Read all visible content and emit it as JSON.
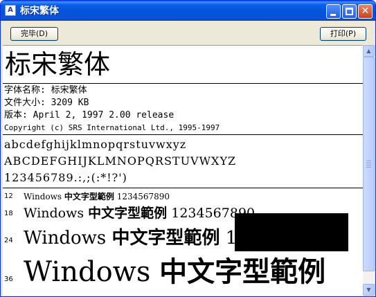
{
  "window": {
    "title": "标宋繁体",
    "icon": "font-file-icon",
    "icon_glyph": "A",
    "close_glyph": "✕"
  },
  "toolbar": {
    "done_label": "完毕(D)",
    "print_label": "打印(P)"
  },
  "preview": {
    "font_display_name": "标宋繁体",
    "info": {
      "name_line": "字体名称: 标宋繁体",
      "size_line": "文件大小: 3209 KB",
      "version_line": "版本: April 2, 1997 2.00 release",
      "copyright_line": "Copyright (c) SRS International Ltd., 1995-1997"
    },
    "samples": {
      "lowercase": "abcdefghijklmnopqrstuvwxyz",
      "uppercase": "ABCDEFGHIJKLMNOPQRSTUVWXYZ",
      "digits": "123456789.:,;(:*!?')"
    },
    "size_rows": [
      {
        "size": "12",
        "latin": "Windows",
        "cjk": "中文字型範例",
        "digits": "1234567890"
      },
      {
        "size": "18",
        "latin": "Windows",
        "cjk": "中文字型範例",
        "digits": "1234567890"
      },
      {
        "size": "24",
        "latin": "Windows",
        "cjk": "中文字型範例",
        "digits": "1234567890"
      },
      {
        "size": "36",
        "latin": "Windows",
        "cjk": "中文字型範例",
        "digits": ""
      }
    ]
  },
  "scrollbar": {
    "up_glyph": "▲",
    "down_glyph": "▼"
  },
  "colors": {
    "titlebar": "#0453d6",
    "window_bg": "#ece9d8",
    "view_bg": "#ffffff",
    "redaction": "#000000"
  }
}
